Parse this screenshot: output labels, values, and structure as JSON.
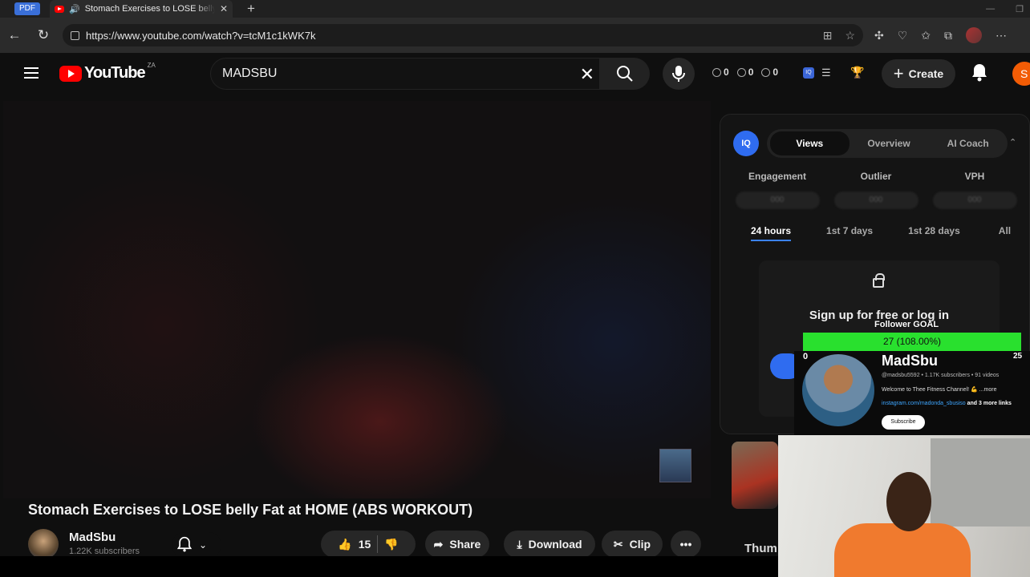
{
  "browser": {
    "pdf_badge": "PDF",
    "tab_title": "Stomach Exercises to LOSE belly Fat at HOME (ABS WORKOUT)",
    "url": "https://www.youtube.com/watch?v=tcM1c1kWK7k"
  },
  "header": {
    "logo_text": "YouTube",
    "country": "ZA",
    "search_value": "MADSBU",
    "stats": [
      "0",
      "0",
      "0"
    ],
    "create_label": "Create",
    "avatar_letter": "S"
  },
  "video": {
    "title": "Stomach Exercises to LOSE belly Fat at HOME (ABS WORKOUT)",
    "channel_name": "MadSbu",
    "subscribers": "1.22K subscribers",
    "likes": "15",
    "share_label": "Share",
    "download_label": "Download",
    "clip_label": "Clip"
  },
  "panel": {
    "logo": "IQ",
    "tabs": [
      "Views",
      "Overview",
      "AI Coach"
    ],
    "active_tab": "Views",
    "metrics": [
      {
        "label": "Engagement",
        "value": "000"
      },
      {
        "label": "Outlier",
        "value": "000"
      },
      {
        "label": "VPH",
        "value": "000"
      }
    ],
    "ranges": [
      "24 hours",
      "1st 7 days",
      "1st 28 days",
      "All"
    ],
    "lock_message": "Sign up for free or log in",
    "below_label": "Thum"
  },
  "overlay": {
    "goal_label": "Follower GOAL",
    "goal_progress": "27 (108.00%)",
    "goal_fraction": 1.0,
    "goal_min": "0",
    "goal_max": "25",
    "card_name": "MadSbu",
    "card_meta": "@madsbu5592 • 1.17K subscribers • 91 videos",
    "card_desc": "Welcome to Thee Fitness Channel! 💪 ...more",
    "card_link": "instagram.com/madonda_sbusiso",
    "card_more_links": "and 3 more links",
    "card_subscribe": "Subscribe"
  },
  "colors": {
    "brand_red": "#ff0000",
    "accent_blue": "#2f6cf0",
    "goal_green": "#29e02e",
    "avatar_orange": "#f25c05"
  }
}
